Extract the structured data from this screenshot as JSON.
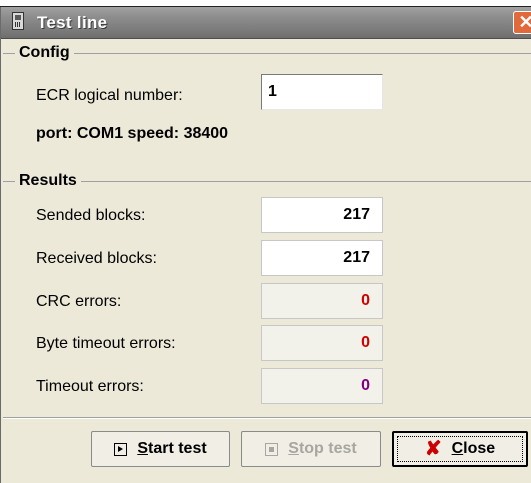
{
  "window": {
    "title": "Test line",
    "close_glyph": "✕"
  },
  "config": {
    "group_title": "Config",
    "ecr_label": "ECR logical number:",
    "ecr_value": "1",
    "port_line": "port: COM1   speed: 38400"
  },
  "results": {
    "group_title": "Results",
    "rows": [
      {
        "label": "Sended blocks:",
        "value": "217",
        "color": "#000000"
      },
      {
        "label": "Received blocks:",
        "value": "217",
        "color": "#000000"
      },
      {
        "label": "CRC errors:",
        "value": "0",
        "color": "#d00000"
      },
      {
        "label": "Byte timeout errors:",
        "value": "0",
        "color": "#d00000"
      },
      {
        "label": "Timeout errors:",
        "value": "0",
        "color": "#800080"
      }
    ]
  },
  "buttons": {
    "start_underline": "S",
    "start_rest": "tart test",
    "stop_underline": "S",
    "stop_rest": "top test",
    "close_underline": "C",
    "close_rest": "lose",
    "close_icon_glyph": "✘"
  }
}
